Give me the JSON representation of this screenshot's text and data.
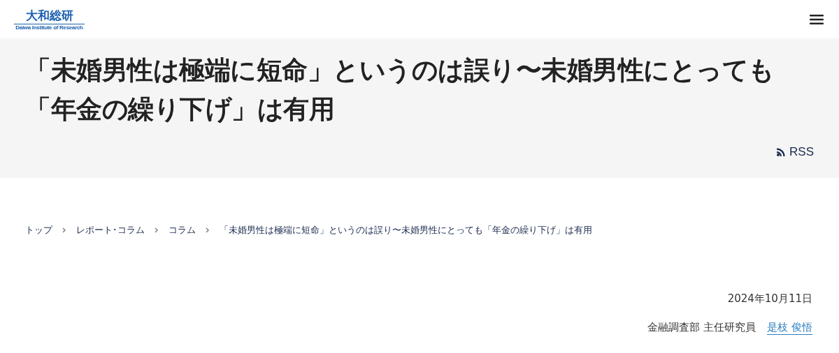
{
  "header": {
    "logo": {
      "name": "大和総研",
      "subtitle": "Daiwa Institute of Research"
    }
  },
  "title": {
    "lines": [
      "「未婚男性は極端に短命」というのは誤り〜未婚男性にとっても",
      "「年金の繰り下げ」は有用"
    ],
    "rss": "RSS"
  },
  "breadcrumbs": [
    {
      "label": "トップ"
    },
    {
      "label": "レポート･コラム"
    },
    {
      "label": "コラム"
    },
    {
      "label": "「未婚男性は極端に短命」というのは誤り〜未婚男性にとっても「年金の繰り下げ」は有用"
    }
  ],
  "meta": {
    "date": "2024年10月11日",
    "department": "金融調査部 主任研究員",
    "author": "是枝 俊悟"
  }
}
